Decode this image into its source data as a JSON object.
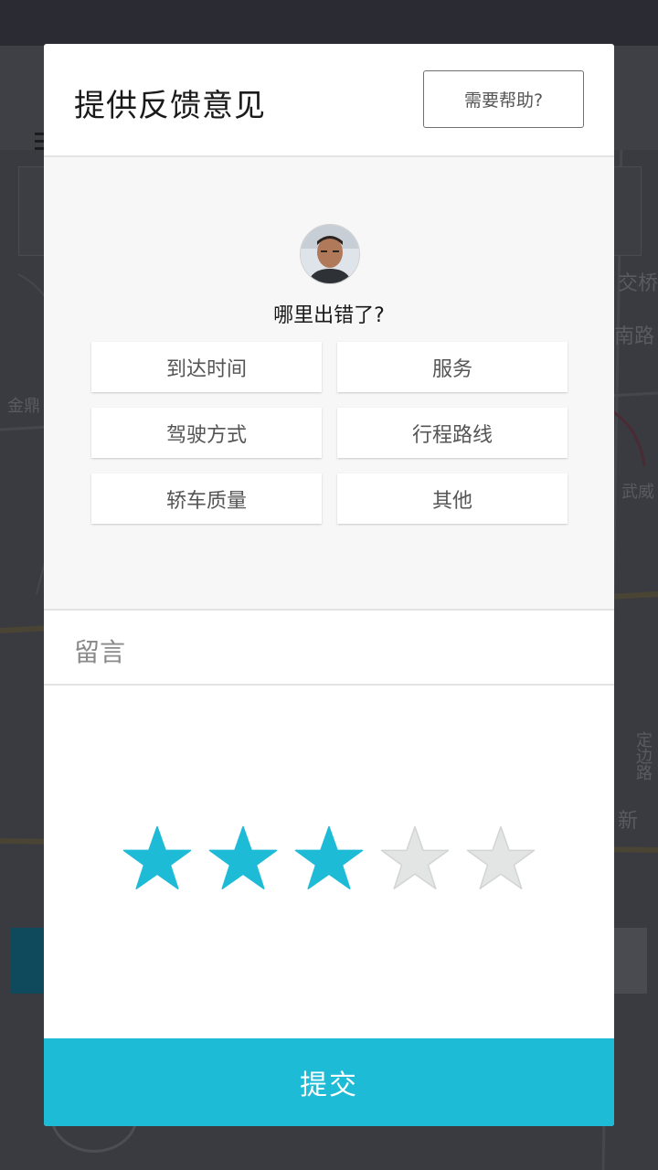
{
  "modal": {
    "title": "提供反馈意见",
    "help_label": "需要帮助?",
    "question": "哪里出错了?",
    "options": [
      "到达时间",
      "服务",
      "驾驶方式",
      "行程路线",
      "轿车质量",
      "其他"
    ],
    "comment_placeholder": "留言",
    "rating": {
      "value": 3,
      "max": 5
    },
    "submit_label": "提交"
  },
  "background_map": {
    "labels": [
      "交桥",
      "南路",
      "武威",
      "金鼎",
      "定边路",
      "新"
    ]
  },
  "colors": {
    "accent": "#1ebbd7",
    "star_active": "#1ebbd7",
    "star_inactive": "#e3e4e4",
    "overlay": "#2c2d33"
  },
  "icons": {
    "avatar": "driver-avatar",
    "star": "star-icon",
    "menu": "menu-icon"
  }
}
